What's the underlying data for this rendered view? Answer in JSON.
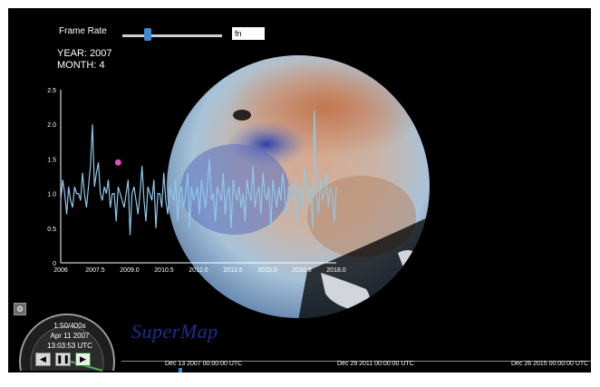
{
  "controls": {
    "frame_rate_label": "Frame Rate",
    "frame_rate_value": "fn",
    "frame_rate_level": 0.25
  },
  "status": {
    "year": "YEAR: 2007",
    "month": "MONTH: 4"
  },
  "clock": {
    "line1": "1:50/400s",
    "line2": "Apr 11 2007",
    "line3": "13:03:53 UTC",
    "rewind_icon": "rewind-icon",
    "pause_icon": "pause-icon",
    "play_icon": "play-icon"
  },
  "brand": {
    "text": "SuperMap"
  },
  "timeline": {
    "labels": [
      "Dec 13 2007 00:00:00 UTC",
      "Dec 29 2011 00:00:00 UTC",
      "Dec 26 2015 00:00:00 UTC"
    ]
  },
  "colors": {
    "background": "#000000",
    "series": "#8fc8ea",
    "marker": "#d94fc4",
    "brand": "#1d2f8f",
    "accent": "#3a8ad6"
  },
  "chart_data": {
    "type": "line",
    "x_tick_labels": [
      "2006",
      "2007.5",
      "2009.0",
      "2010.5",
      "2012.0",
      "2013.5",
      "2015.0",
      "2016.5",
      "2018.0"
    ],
    "y_tick_labels": [
      "0",
      "0.5",
      "1.0",
      "1.5",
      "2.0",
      "2.5"
    ],
    "xlim": [
      2006,
      2018
    ],
    "ylim": [
      0,
      2.5
    ],
    "highlight_point": [
      2008.5,
      1.45
    ],
    "series": [
      {
        "values": [
          0.9,
          1.2,
          1.0,
          0.7,
          1.1,
          0.9,
          0.8,
          1.1,
          1.0,
          1.0,
          0.9,
          1.3,
          1.0,
          0.8,
          1.1,
          1.4,
          2.0,
          1.1,
          1.3,
          1.45,
          1.0,
          0.9,
          1.1,
          1.0,
          1.2,
          0.8,
          1.0,
          1.0,
          0.6,
          1.1,
          1.0,
          0.9,
          0.8,
          1.0,
          1.2,
          0.4,
          1.0,
          1.1,
          0.9,
          0.7,
          1.0,
          1.4,
          0.9,
          0.6,
          1.1,
          1.0,
          0.9,
          1.2,
          0.5,
          1.0,
          1.0,
          0.8,
          1.3,
          0.9,
          0.7,
          1.1,
          1.0,
          0.9,
          1.2,
          0.6,
          1.0,
          1.1,
          0.8,
          1.0,
          1.3,
          0.5,
          1.1,
          0.9,
          1.0,
          1.1,
          0.7,
          1.2,
          1.0,
          0.8,
          1.1,
          1.5,
          0.9,
          1.0,
          0.6,
          1.1,
          1.0,
          0.9,
          1.3,
          0.7,
          1.0,
          1.1,
          0.5,
          1.2,
          1.0,
          0.9,
          1.1,
          0.8,
          1.0,
          0.6,
          1.2,
          1.0,
          0.9,
          1.4,
          0.8,
          1.0,
          1.1,
          0.7,
          1.3,
          1.0,
          0.9,
          1.1,
          0.5,
          1.2,
          1.0,
          0.8,
          1.1,
          0.9,
          1.3,
          1.0,
          0.7,
          1.1,
          1.0,
          0.9,
          1.2,
          0.6,
          1.0,
          1.1,
          0.8,
          1.4,
          1.0,
          0.9,
          1.1,
          0.5,
          2.2,
          1.0,
          0.7,
          1.2,
          0.9,
          1.0,
          1.3,
          0.8,
          1.1,
          1.0,
          0.6,
          1.1
        ]
      }
    ]
  }
}
